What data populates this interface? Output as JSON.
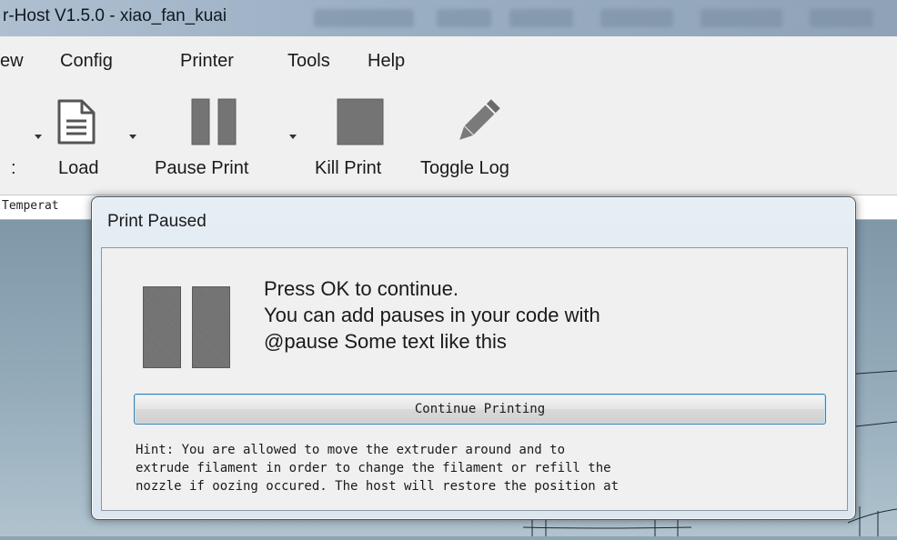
{
  "window": {
    "title": "r-Host V1.5.0 - xiao_fan_kuai"
  },
  "menu": {
    "items": [
      {
        "label": "ew"
      },
      {
        "label": "Config"
      },
      {
        "label": "Printer"
      },
      {
        "label": "Tools"
      },
      {
        "label": "Help"
      }
    ]
  },
  "toolbar": {
    "left_partial_label": ":",
    "load_label": "Load",
    "pause_label": "Pause Print",
    "kill_label": "Kill Print",
    "toggle_log_label": "Toggle Log",
    "icons": {
      "load": "document-icon",
      "pause": "pause-icon",
      "kill": "stop-icon",
      "toggle_log": "pencil-icon"
    }
  },
  "strip": {
    "text": "Temperat"
  },
  "dialog": {
    "title": "Print Paused",
    "message_lines": [
      "Press OK to continue.",
      "You can add pauses in your code with",
      "@pause Some text like this"
    ],
    "continue_button": "Continue Printing",
    "hint": "Hint: You are allowed to move the extruder around and to\nextrude filament in order to change the filament or refill the\nnozzle if oozing occured. The host will restore the position at"
  },
  "colors": {
    "button_focus_border": "#3c7fb1",
    "dialog_frame": "#dbe6ef",
    "pause_glyph": "#747474"
  }
}
